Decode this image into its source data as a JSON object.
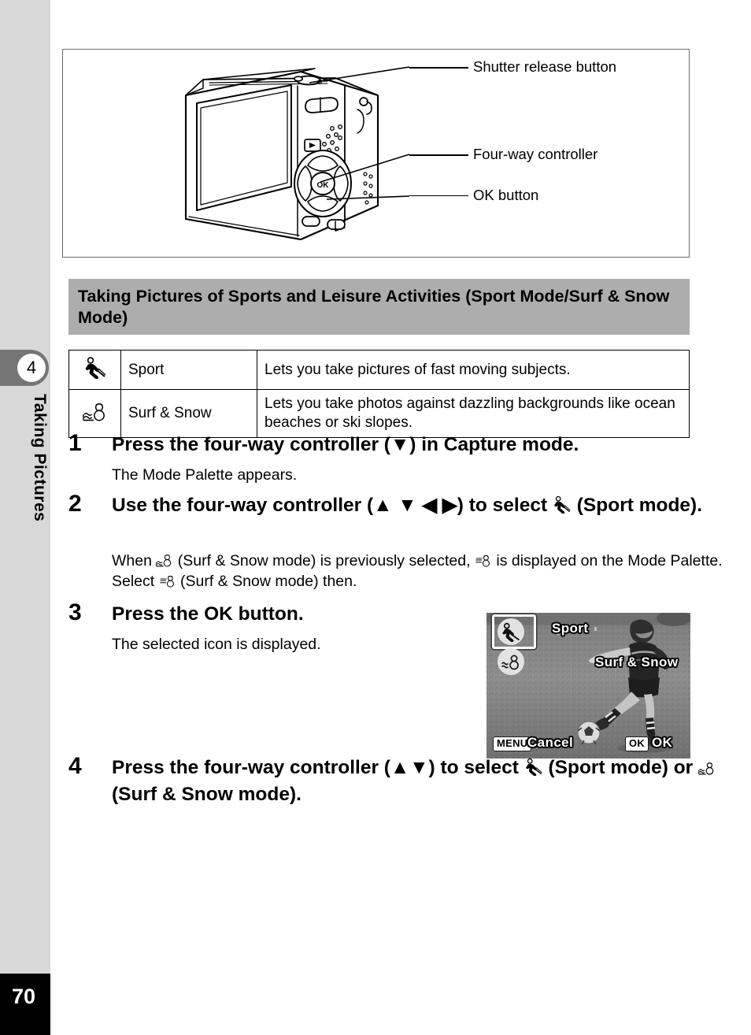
{
  "sidebar": {
    "chapter_number": "4",
    "chapter_title": "Taking Pictures",
    "page_number": "70"
  },
  "figure": {
    "illustration_name": "digital-camera-rear-view",
    "callouts": [
      {
        "label": "Shutter release button",
        "target": "shutter-release-button"
      },
      {
        "label": "Four-way controller",
        "target": "four-way-controller"
      },
      {
        "label": "OK button",
        "target": "ok-button"
      }
    ]
  },
  "section": {
    "heading": "Taking Pictures of Sports and Leisure Activities (Sport Mode/Surf & Snow Mode)"
  },
  "mode_table": {
    "rows": [
      {
        "icon": "sport-mode-icon",
        "name": "Sport",
        "description": "Lets you take pictures of fast moving subjects."
      },
      {
        "icon": "surf-snow-mode-icon",
        "name": "Surf & Snow",
        "description": "Lets you take photos against dazzling backgrounds like ocean beaches or ski slopes."
      }
    ]
  },
  "steps": [
    {
      "number": "1",
      "title_pre": "Press the four-way controller (",
      "title_arrows": "▼",
      "title_post": ") in Capture mode.",
      "body": "The Mode Palette appears."
    },
    {
      "number": "2",
      "title_pre": "Use the four-way controller (",
      "title_arrows": "▲ ▼ ◀ ▶",
      "title_mid": ") to select ",
      "title_post": " (Sport mode).",
      "body_1": "When ",
      "body_2": " (Surf & Snow mode) is previously selected, ",
      "body_3": " is displayed on the Mode Palette. Select ",
      "body_4": " (Surf & Snow mode) then."
    },
    {
      "number": "3",
      "title": "Press the OK button.",
      "body": "The selected icon is displayed."
    },
    {
      "number": "4",
      "title_pre": "Press the four-way controller (",
      "title_arrows": "▲▼",
      "title_mid": ") to select ",
      "title_mid2": " (Sport mode) or ",
      "title_post": " (Surf & Snow mode)."
    }
  ],
  "lcd_screen": {
    "sport_label": "Sport",
    "surf_snow_label": "Surf & Snow",
    "menu_key": "MENU",
    "cancel_label": "Cancel",
    "ok_key": "OK",
    "ok_label": "OK",
    "selected_mode": "Sport",
    "photo_description": "child-kicking-soccer-ball-on-grass"
  },
  "colors": {
    "sidebar_gray": "#d8d8d8",
    "tab_gray": "#757575",
    "heading_band_gray": "#adadad",
    "page_block_black": "#000000"
  }
}
